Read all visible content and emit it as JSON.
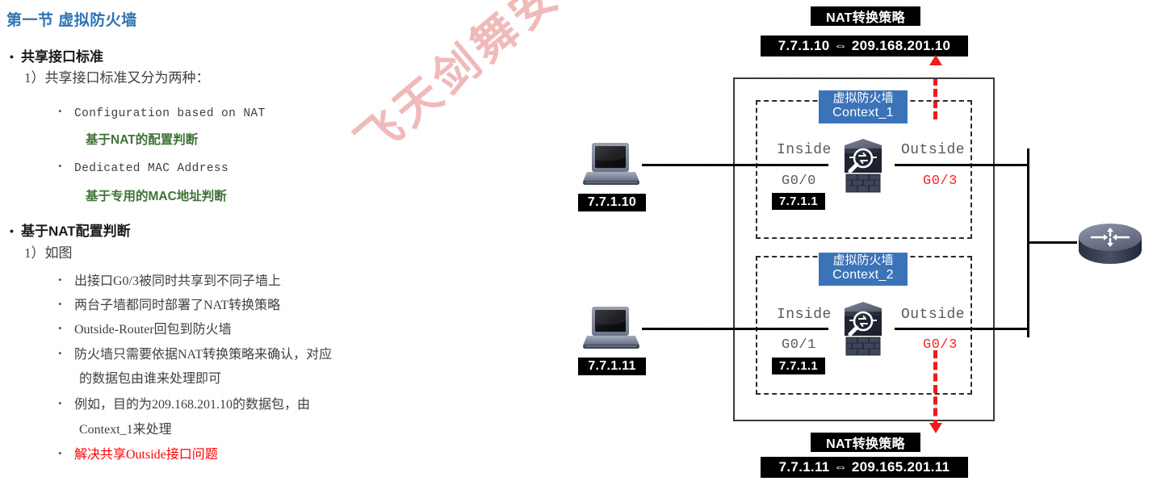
{
  "slide": {
    "title": "第一节 虚拟防火墙"
  },
  "outline": {
    "section1": {
      "heading": "共享接口标准",
      "item1": "1）共享接口标准又分为两种：",
      "sub1_en": "Configuration based on NAT",
      "sub1_cn": "基于NAT的配置判断",
      "sub2_en": "Dedicated MAC Address",
      "sub2_cn": "基于专用的MAC地址判断"
    },
    "section2": {
      "heading": "基于NAT配置判断",
      "item1": "1）如图",
      "bullets": [
        "出接口G0/3被同时共享到不同子墙上",
        "两台子墙都同时部署了NAT转换策略",
        "Outside-Router回包到防火墙",
        "防火墙只需要依据NAT转换策略来确认，对应",
        "例如，目的为209.168.201.10的数据包，由",
        "解决共享Outside接口问题"
      ],
      "wrap1": "的数据包由谁来处理即可",
      "wrap2": "Context_1来处理"
    }
  },
  "watermark": {
    "text": "飞天剑舞安全实验室"
  },
  "diagram": {
    "nat_top": {
      "label": "NAT转换策略",
      "value": "7.7.1.10 ⇔ 209.168.201.10"
    },
    "nat_bottom": {
      "label": "NAT转换策略",
      "value": "7.7.1.11 ⇔ 209.165.201.11"
    },
    "hosts": [
      {
        "ip": "7.7.1.10"
      },
      {
        "ip": "7.7.1.11"
      }
    ],
    "contexts": [
      {
        "title_cn": "虚拟防火墙",
        "title_en": "Context_1",
        "inside_zone": "Inside",
        "inside_if": "G0/0",
        "inside_ip": "7.7.1.1",
        "outside_zone": "Outside",
        "outside_if": "G0/3"
      },
      {
        "title_cn": "虚拟防火墙",
        "title_en": "Context_2",
        "inside_zone": "Inside",
        "inside_if": "G0/1",
        "inside_ip": "7.7.1.1",
        "outside_zone": "Outside",
        "outside_if": "G0/3"
      }
    ]
  },
  "colors": {
    "title_blue": "#2E74B5",
    "context_blue": "#3b73b9",
    "accent_red": "#ff0000",
    "dash_red": "#ee1c1c",
    "note_green": "#3f7337",
    "watermark_pink": "#e57a7a"
  }
}
